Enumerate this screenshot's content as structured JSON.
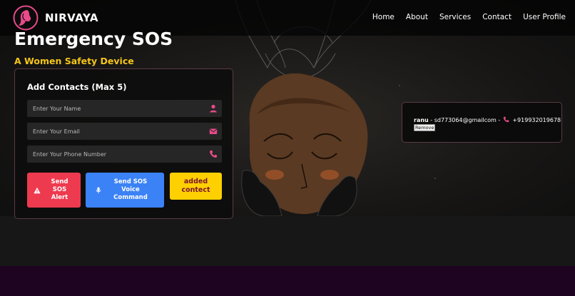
{
  "brand": {
    "name": "NIRVAYA"
  },
  "nav": {
    "items": [
      "Home",
      "About",
      "Services",
      "Contact",
      "User Profile"
    ]
  },
  "hero": {
    "title": "Emergency SOS",
    "subtitle": "A Women Safety Device"
  },
  "contacts_form": {
    "title": "Add Contacts (Max 5)",
    "name_placeholder": "Enter Your Name",
    "email_placeholder": "Enter Your Email",
    "phone_placeholder": "Enter Your Phone Number",
    "send_sos_label": "Send SOS Alert",
    "send_voice_label": "Send SOS Voice Command",
    "added_label": "added contect"
  },
  "contact_list": {
    "items": [
      {
        "name": "ranu",
        "email": "sd773064@gmailcom",
        "phone": "+919932019678",
        "separator": "-",
        "remove_label": "Remove"
      }
    ]
  },
  "colors": {
    "accent_pink": "#e84a8a",
    "subtitle_yellow": "#f5c518",
    "sos_red": "#ee3a4f",
    "voice_blue": "#3b82f6",
    "added_yellow": "#ffd000",
    "footer_purple": "#1e0420"
  },
  "icons": {
    "logo": "woman-profile-logo-icon",
    "name_field": "user-icon",
    "email_field": "envelope-icon",
    "phone_field": "phone-icon",
    "sos": "warning-triangle-icon",
    "voice": "microphone-icon"
  }
}
